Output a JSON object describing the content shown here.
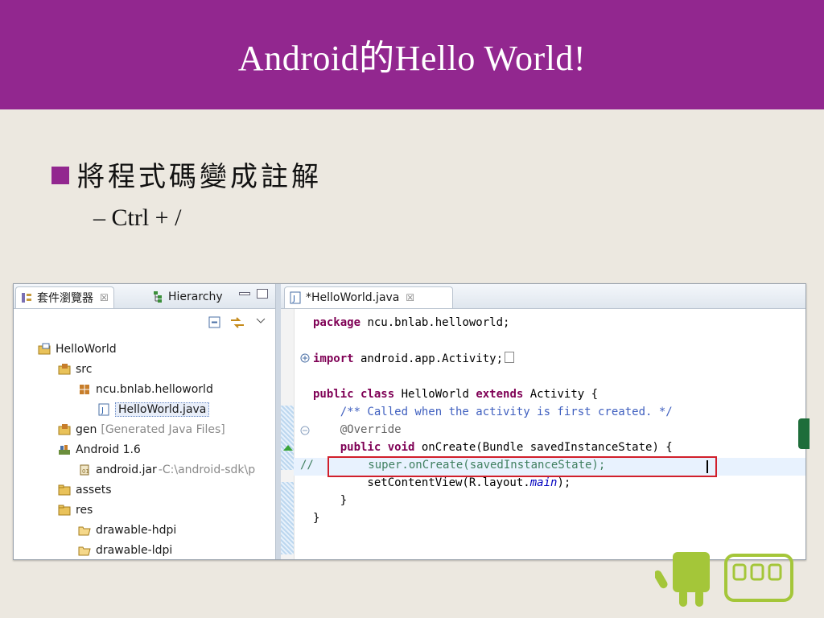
{
  "slide": {
    "title": "Android的Hello World!",
    "bullet": "將程式碼變成註解",
    "sub_bullet": "– Ctrl + /"
  },
  "colors": {
    "accent": "#92278f",
    "background": "#ece8e0",
    "highlight_box": "#d11f2b"
  },
  "left_panel": {
    "tabs": [
      {
        "label": "套件瀏覽器",
        "icon": "package-explorer-icon"
      },
      {
        "label": "Hierarchy",
        "icon": "hierarchy-icon"
      }
    ],
    "tree": [
      {
        "label": "HelloWorld",
        "icon": "project-icon"
      },
      {
        "label": "src",
        "icon": "source-folder-icon"
      },
      {
        "label": "ncu.bnlab.helloworld",
        "icon": "package-icon"
      },
      {
        "label": "HelloWorld.java",
        "icon": "java-file-icon"
      },
      {
        "label": "gen",
        "suffix": "[Generated Java Files]",
        "icon": "source-folder-icon"
      },
      {
        "label": "Android 1.6",
        "icon": "library-icon"
      },
      {
        "label": "android.jar",
        "suffix": "-C:\\android-sdk\\p",
        "icon": "jar-icon"
      },
      {
        "label": "assets",
        "icon": "folder-icon"
      },
      {
        "label": "res",
        "icon": "folder-icon"
      },
      {
        "label": "drawable-hdpi",
        "icon": "folder-open-icon"
      },
      {
        "label": "drawable-ldpi",
        "icon": "folder-open-icon"
      }
    ]
  },
  "editor": {
    "tab_label": "*HelloWorld.java",
    "lines": {
      "l1_kw": "package",
      "l1_rest": " ncu.bnlab.helloworld;",
      "l2_kw": "import",
      "l2_rest": " android.app.Activity;",
      "l3_kw1": "public class",
      "l3_mid": " HelloWorld ",
      "l3_kw2": "extends",
      "l3_rest": " Activity {",
      "l4": "    /** Called when the activity is first created. */",
      "l5": "    @Override",
      "l6_kw": "    public void",
      "l6_rest": " onCreate(Bundle savedInstanceState) {",
      "l7_comment": "//",
      "l7_code": "        super.onCreate(savedInstanceState);",
      "l8_pre": "        setContentView(R.layout.",
      "l8_it": "main",
      "l8_post": ");",
      "l9": "    }",
      "l10": "}"
    }
  }
}
